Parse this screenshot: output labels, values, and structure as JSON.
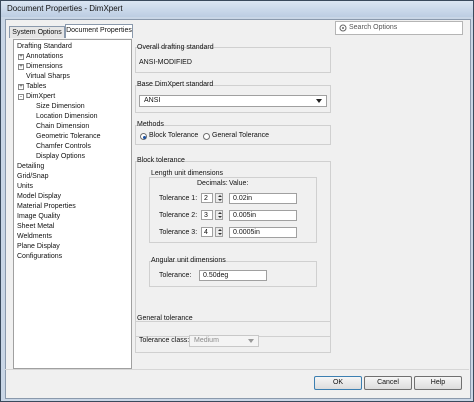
{
  "window": {
    "title": "Document Properties - DimXpert"
  },
  "tabs": [
    {
      "label": "System Options"
    },
    {
      "label": "Document Properties"
    }
  ],
  "search": {
    "placeholder": "Search Options"
  },
  "tree": [
    {
      "label": "Drafting Standard",
      "level": 0,
      "expander": ""
    },
    {
      "label": "Annotations",
      "level": 1,
      "expander": "+"
    },
    {
      "label": "Dimensions",
      "level": 1,
      "expander": "+"
    },
    {
      "label": "Virtual Sharps",
      "level": 1,
      "expander": ""
    },
    {
      "label": "Tables",
      "level": 1,
      "expander": "+"
    },
    {
      "label": "DimXpert",
      "level": 1,
      "expander": "-"
    },
    {
      "label": "Size Dimension",
      "level": 2,
      "expander": ""
    },
    {
      "label": "Location Dimension",
      "level": 2,
      "expander": ""
    },
    {
      "label": "Chain Dimension",
      "level": 2,
      "expander": ""
    },
    {
      "label": "Geometric Tolerance",
      "level": 2,
      "expander": ""
    },
    {
      "label": "Chamfer Controls",
      "level": 2,
      "expander": ""
    },
    {
      "label": "Display Options",
      "level": 2,
      "expander": ""
    },
    {
      "label": "Detailing",
      "level": 0,
      "expander": ""
    },
    {
      "label": "Grid/Snap",
      "level": 0,
      "expander": ""
    },
    {
      "label": "Units",
      "level": 0,
      "expander": ""
    },
    {
      "label": "Model Display",
      "level": 0,
      "expander": ""
    },
    {
      "label": "Material Properties",
      "level": 0,
      "expander": ""
    },
    {
      "label": "Image Quality",
      "level": 0,
      "expander": ""
    },
    {
      "label": "Sheet Metal",
      "level": 0,
      "expander": ""
    },
    {
      "label": "Weldments",
      "level": 0,
      "expander": ""
    },
    {
      "label": "Plane Display",
      "level": 0,
      "expander": ""
    },
    {
      "label": "Configurations",
      "level": 0,
      "expander": ""
    }
  ],
  "overall": {
    "title": "Overall drafting standard",
    "value": "ANSI-MODIFIED"
  },
  "base": {
    "title": "Base DimXpert standard",
    "value": "ANSI"
  },
  "methods": {
    "title": "Methods",
    "options": [
      {
        "label": "Block Tolerance",
        "selected": true
      },
      {
        "label": "General Tolerance",
        "selected": false
      }
    ]
  },
  "block": {
    "title": "Block tolerance",
    "length": {
      "title": "Length unit dimensions",
      "col_decimals": "Decimals:",
      "col_value": "Value:",
      "rows": [
        {
          "label": "Tolerance 1:",
          "decimals": "2",
          "value": "0.02in"
        },
        {
          "label": "Tolerance 2:",
          "decimals": "3",
          "value": "0.005in"
        },
        {
          "label": "Tolerance 3:",
          "decimals": "4",
          "value": "0.0005in"
        }
      ]
    },
    "angular": {
      "title": "Angular unit dimensions",
      "label": "Tolerance:",
      "value": "0.50deg"
    }
  },
  "general": {
    "title": "General tolerance",
    "class_label": "Tolerance class:",
    "class_value": "Medium"
  },
  "buttons": {
    "ok": "OK",
    "cancel": "Cancel",
    "help": "Help"
  }
}
